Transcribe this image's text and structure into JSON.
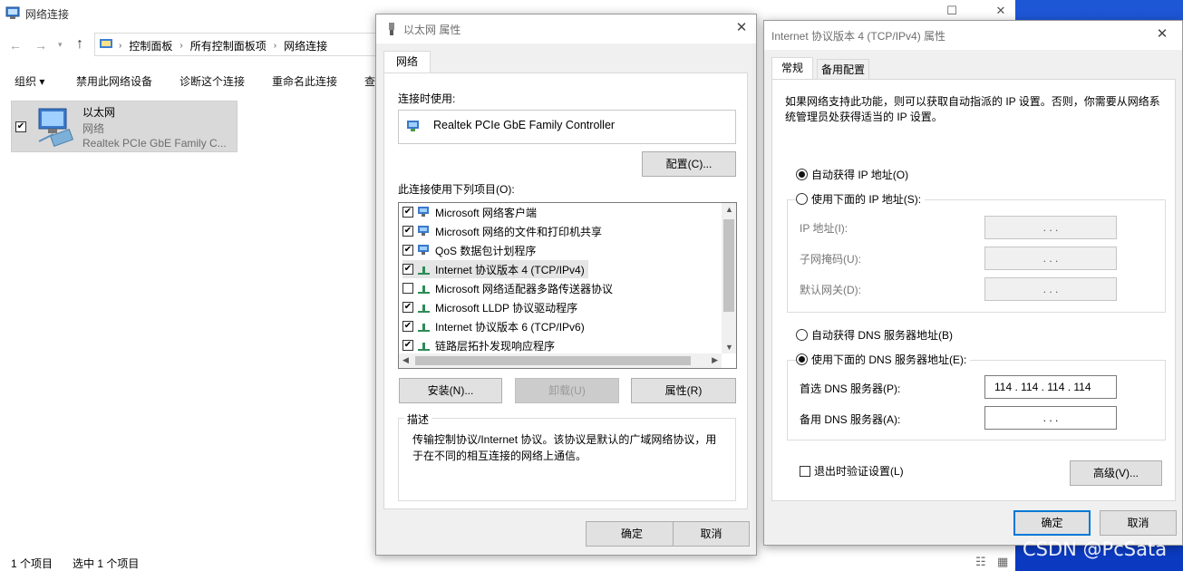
{
  "explorer": {
    "title": "网络连接",
    "window_controls": {
      "minimize": "—",
      "maximize": "☐",
      "close": "✕"
    },
    "breadcrumbs": [
      "控制面板",
      "所有控制面板项",
      "网络连接"
    ],
    "toolbar": [
      "组织 ▾",
      "禁用此网络设备",
      "诊断这个连接",
      "重命名此连接",
      "查"
    ],
    "item": {
      "name": "以太网",
      "type": "网络",
      "adapter": "Realtek PCIe GbE Family C..."
    },
    "status": {
      "count": "1 个项目",
      "selected": "选中 1 个项目"
    }
  },
  "ethernet_dialog": {
    "title": "以太网 属性",
    "tab": "网络",
    "connect_using_label": "连接时使用:",
    "adapter": "Realtek PCIe GbE Family Controller",
    "configure_button": "配置(C)...",
    "items_label": "此连接使用下列项目(O):",
    "items": [
      {
        "label": "Microsoft 网络客户端",
        "checked": true,
        "icon": "network-client-icon"
      },
      {
        "label": "Microsoft 网络的文件和打印机共享",
        "checked": true,
        "icon": "file-share-icon"
      },
      {
        "label": "QoS 数据包计划程序",
        "checked": true,
        "icon": "qos-icon"
      },
      {
        "label": "Internet 协议版本 4 (TCP/IPv4)",
        "checked": true,
        "icon": "protocol-icon"
      },
      {
        "label": "Microsoft 网络适配器多路传送器协议",
        "checked": false,
        "icon": "protocol-icon"
      },
      {
        "label": "Microsoft LLDP 协议驱动程序",
        "checked": true,
        "icon": "protocol-icon"
      },
      {
        "label": "Internet 协议版本 6 (TCP/IPv6)",
        "checked": true,
        "icon": "protocol-icon"
      },
      {
        "label": "链路层拓扑发现响应程序",
        "checked": true,
        "icon": "protocol-icon"
      }
    ],
    "buttons": {
      "install": "安装(N)...",
      "uninstall": "卸载(U)",
      "properties": "属性(R)"
    },
    "description_label": "描述",
    "description": "传输控制协议/Internet 协议。该协议是默认的广域网络协议，用于在不同的相互连接的网络上通信。",
    "ok": "确定",
    "cancel": "取消"
  },
  "ipv4_dialog": {
    "title": "Internet 协议版本 4 (TCP/IPv4) 属性",
    "tabs": [
      "常规",
      "备用配置"
    ],
    "intro": "如果网络支持此功能，则可以获取自动指派的 IP 设置。否则，你需要从网络系统管理员处获得适当的 IP 设置。",
    "auto_ip": "自动获得 IP 地址(O)",
    "manual_ip": "使用下面的 IP 地址(S):",
    "ip_label": "IP 地址(I):",
    "subnet_label": "子网掩码(U):",
    "gateway_label": "默认网关(D):",
    "empty_ip": ".       .       .",
    "auto_dns": "自动获得 DNS 服务器地址(B)",
    "manual_dns": "使用下面的 DNS 服务器地址(E):",
    "preferred_dns_label": "首选 DNS 服务器(P):",
    "preferred_dns_value": "114 . 114 . 114 . 114",
    "alternate_dns_label": "备用 DNS 服务器(A):",
    "validate_label": "退出时验证设置(L)",
    "advanced": "高级(V)...",
    "ok": "确定",
    "cancel": "取消"
  },
  "watermark": "CSDN @PcSata"
}
